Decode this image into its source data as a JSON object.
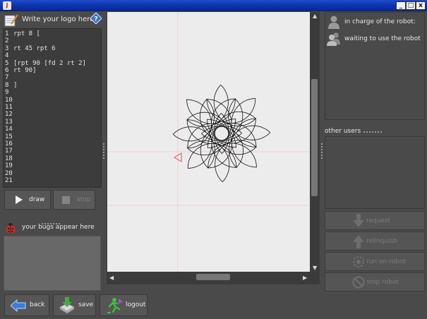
{
  "window": {
    "title": "",
    "controls": [
      "_",
      "□",
      "x"
    ],
    "app_icon": "java-icon"
  },
  "editor_panel": {
    "title": "Write your logo here",
    "help_icon": "help-icon",
    "lines": [
      {
        "n": "1",
        "code": "rpt 8 ["
      },
      {
        "n": "2",
        "code": ""
      },
      {
        "n": "3",
        "code": "rt 45 rpt 6"
      },
      {
        "n": "4",
        "code": ""
      },
      {
        "n": "5",
        "code": "[rpt 90 [fd 2 rt 2]"
      },
      {
        "n": "6",
        "code": "rt 90]"
      },
      {
        "n": "7",
        "code": ""
      },
      {
        "n": "8",
        "code": "]"
      },
      {
        "n": "9",
        "code": ""
      },
      {
        "n": "10",
        "code": ""
      },
      {
        "n": "11",
        "code": ""
      },
      {
        "n": "12",
        "code": ""
      },
      {
        "n": "13",
        "code": ""
      },
      {
        "n": "14",
        "code": ""
      },
      {
        "n": "15",
        "code": ""
      },
      {
        "n": "16",
        "code": ""
      },
      {
        "n": "17",
        "code": ""
      },
      {
        "n": "18",
        "code": ""
      },
      {
        "n": "19",
        "code": ""
      },
      {
        "n": "20",
        "code": ""
      },
      {
        "n": "21",
        "code": ""
      }
    ]
  },
  "run_controls": {
    "draw_label": "draw",
    "stop_label": "stop"
  },
  "bugs_panel": {
    "label": "your bugs appear here"
  },
  "robot_panel": {
    "in_charge_label": "in charge of the robot:",
    "waiting_label": "waiting to use the robot",
    "other_users_label": "other users"
  },
  "robot_buttons": {
    "request": "request",
    "relinquish": "relinquish",
    "run_on_robot": "run on robot",
    "stop_robot": "stop robot"
  },
  "bottom_bar": {
    "back": "back",
    "save": "save",
    "logout": "logout"
  },
  "colors": {
    "background": "#4a4a4a",
    "canvas": "#ececec",
    "grid_line": "#f2b8b8",
    "turtle": "#e25050"
  },
  "drawing": {
    "outer_repeats": 8,
    "inner_repeats": 6,
    "turn_between_petals": 45,
    "arc_steps": 90,
    "step_forward": 2,
    "step_turn": 2
  }
}
